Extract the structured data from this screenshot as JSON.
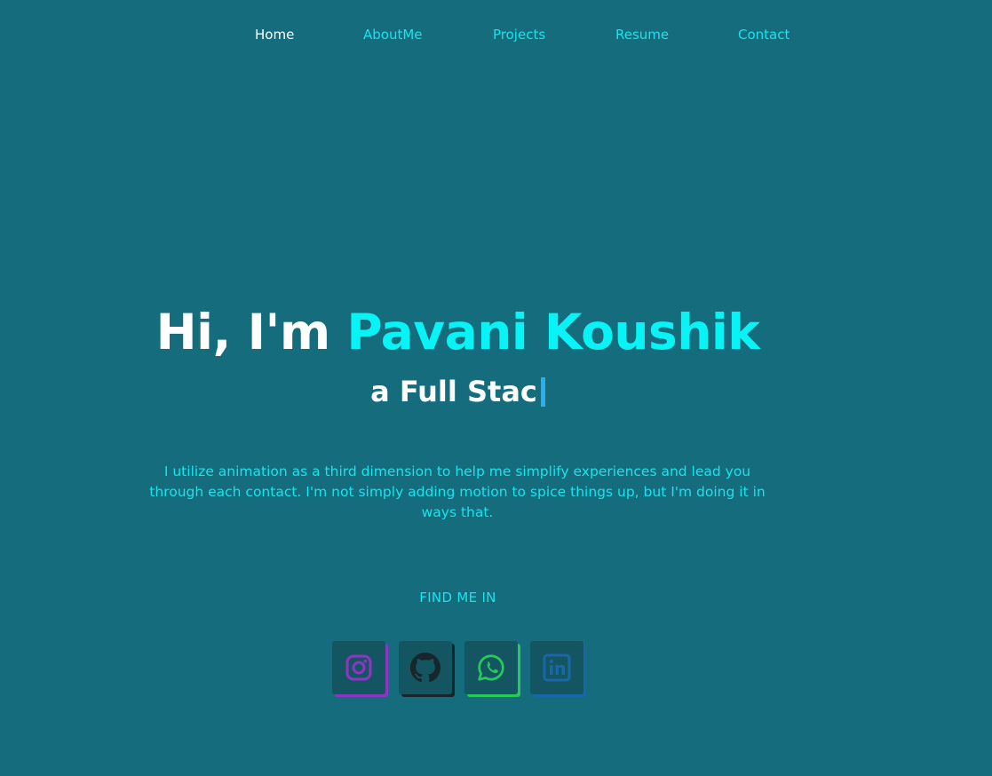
{
  "nav": {
    "items": [
      {
        "label": "Home",
        "active": true
      },
      {
        "label": "AboutMe",
        "active": false
      },
      {
        "label": "Projects",
        "active": false
      },
      {
        "label": "Resume",
        "active": false
      },
      {
        "label": "Contact",
        "active": false
      }
    ]
  },
  "hero": {
    "greeting": "Hi, I'm ",
    "name": "Pavani Koushik",
    "typed_text": "a Full Stac",
    "intro": "I utilize animation as a third dimension to help me simplify experiences and lead you through each contact. I'm not simply adding motion to spice things up, but I'm doing it in ways that."
  },
  "social": {
    "heading": "FIND ME IN",
    "links": [
      {
        "icon": "instagram-icon",
        "color": "#8e35c6"
      },
      {
        "icon": "github-icon",
        "color": "#17262b"
      },
      {
        "icon": "whatsapp-icon",
        "color": "#27c85c"
      },
      {
        "icon": "linkedin-icon",
        "color": "#1867a8"
      }
    ]
  },
  "colors": {
    "background": "#146c7c",
    "accent": "#08f3f5",
    "nav_link": "#19e3ec",
    "cursor": "#2ab0ee"
  }
}
